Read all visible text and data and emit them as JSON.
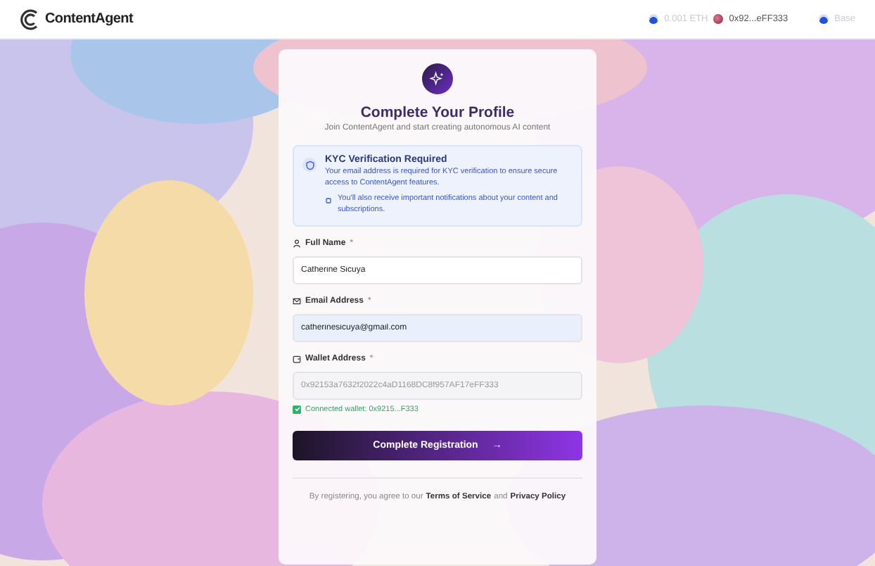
{
  "header": {
    "logo_text": "ContentAgent",
    "balance": "0.001 ETH",
    "wallet": "0x92...eFF333",
    "network": "Base"
  },
  "card": {
    "title": "Complete Your Profile",
    "subtitle": "Join ContentAgent and start creating autonomous AI content",
    "notice": {
      "title": "KYC Verification Required",
      "body": "Your email address is required for KYC verification to ensure secure access to ContentAgent features.",
      "note": "You'll also receive important notifications about your content and subscriptions."
    },
    "fields": [
      {
        "kind": "person",
        "label": "Full Name",
        "required": "*",
        "value": "Catherine Sicuya",
        "disabled": false,
        "highlighted": false
      },
      {
        "kind": "email",
        "label": "Email Address",
        "required": "*",
        "value": "catherinesicuya@gmail.com",
        "disabled": false,
        "highlighted": true
      },
      {
        "kind": "wallet",
        "label": "Wallet Address",
        "required": "*",
        "value": "0x92153a7632f2022c4aD1168DC8f957AF17eFF333",
        "disabled": true,
        "highlighted": false
      }
    ],
    "connected": {
      "text": "Connected wallet: 0x9215...F333",
      "checked": true
    },
    "submit": {
      "label": "Complete Registration",
      "arrow": "→"
    },
    "legal": {
      "prefix": "By registering, you agree to our",
      "terms": "Terms of Service",
      "and": "and",
      "privacy": "Privacy Policy"
    }
  }
}
